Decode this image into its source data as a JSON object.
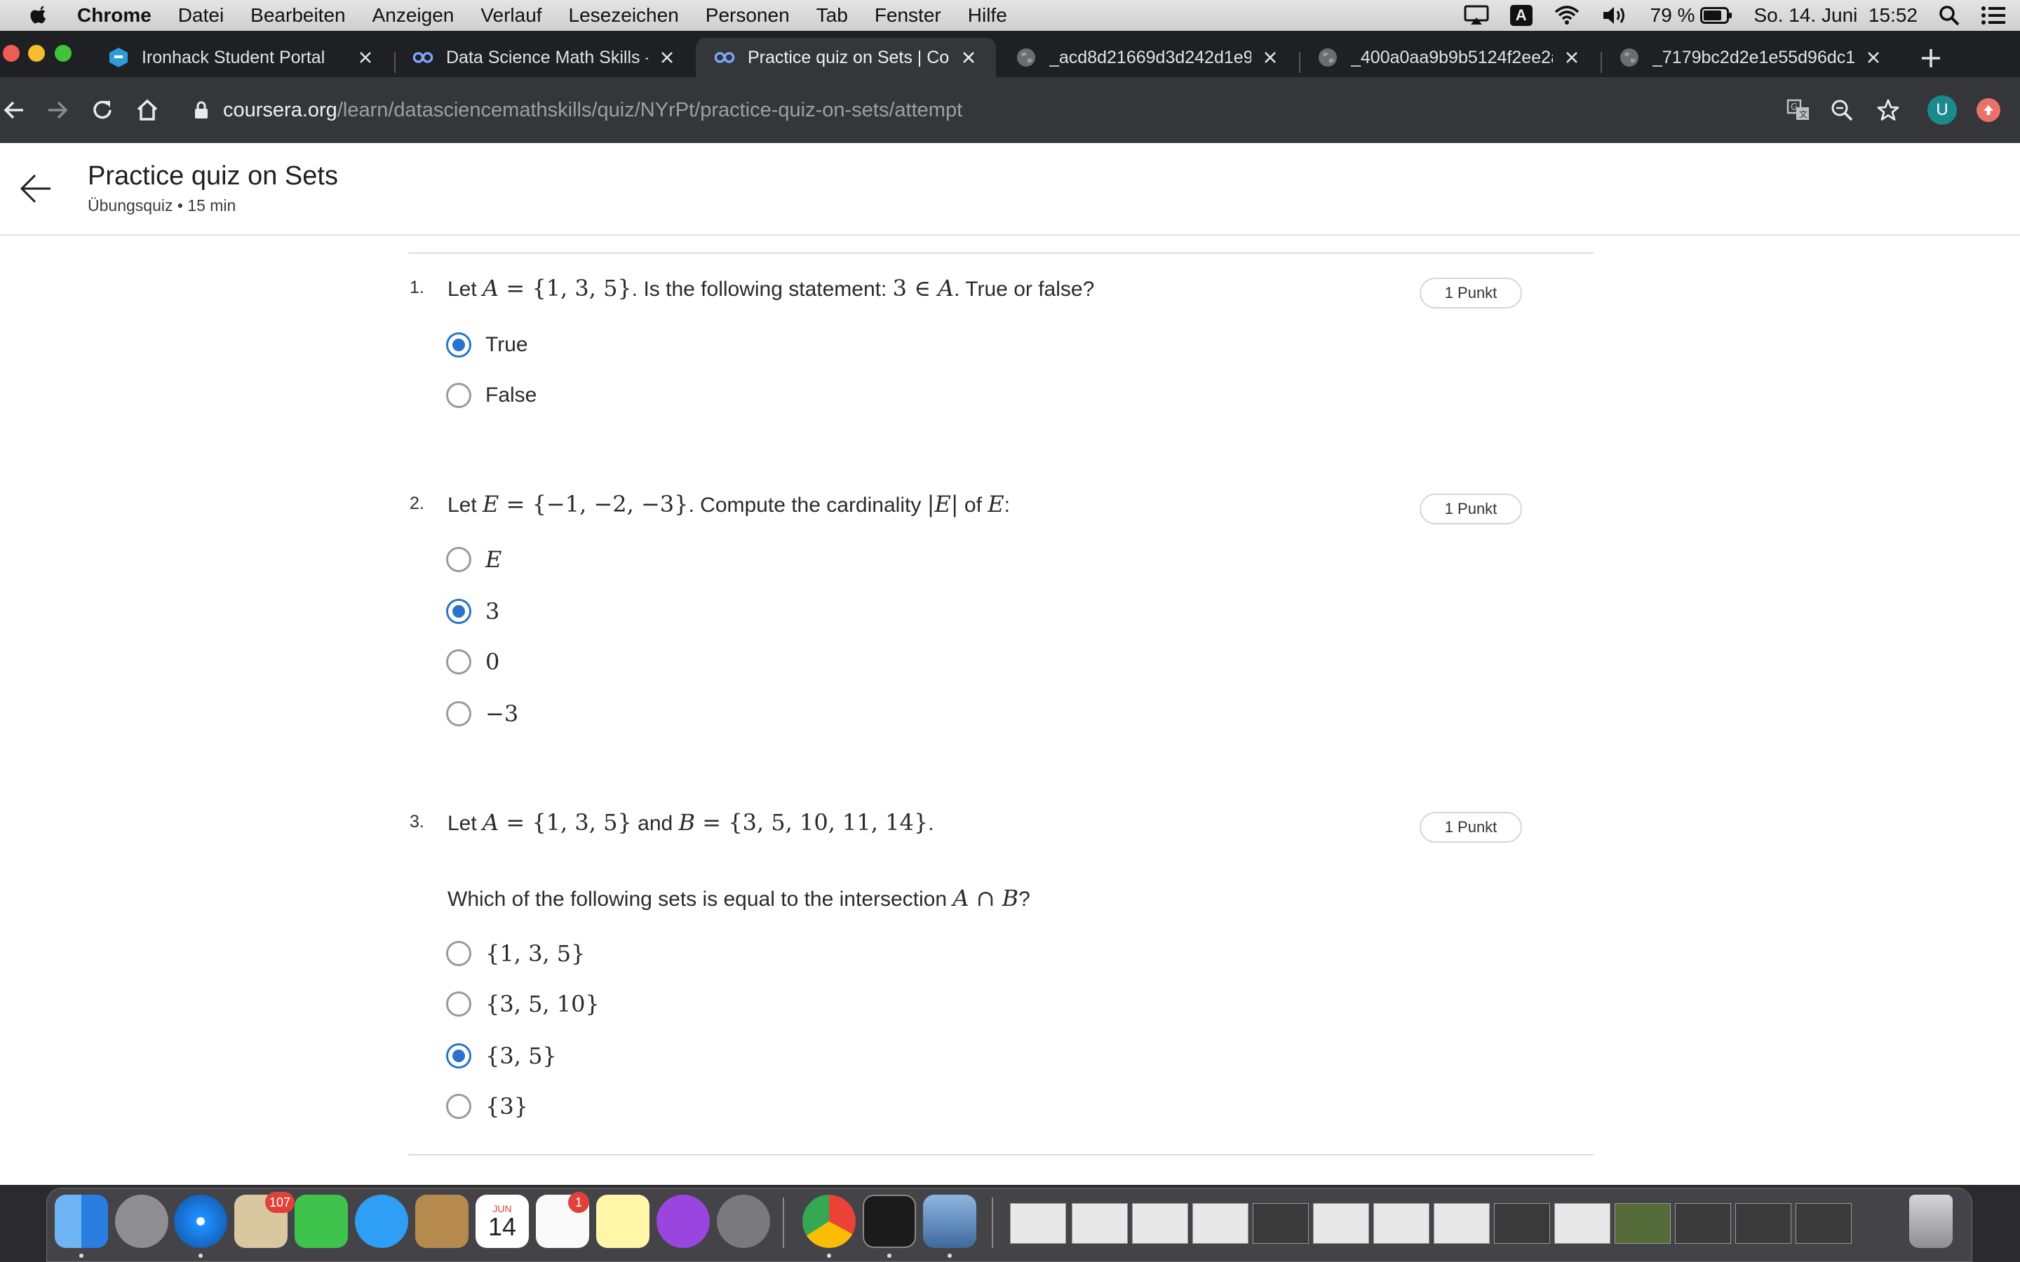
{
  "menubar": {
    "app": "Chrome",
    "items": [
      "Datei",
      "Bearbeiten",
      "Anzeigen",
      "Verlauf",
      "Lesezeichen",
      "Personen",
      "Tab",
      "Fenster",
      "Hilfe"
    ],
    "input_source": "A",
    "battery": "79 %",
    "datetime": "So. 14. Juni  15:52"
  },
  "tabs": [
    {
      "title": "Ironhack Student Portal",
      "icon": "ironhack-icon"
    },
    {
      "title": "Data Science Math Skills -",
      "icon": "coursera-icon"
    },
    {
      "title": "Practice quiz on Sets | Cou",
      "icon": "coursera-icon",
      "active": true
    },
    {
      "title": "_acd8d21669d3d242d1e9",
      "icon": "globe-icon"
    },
    {
      "title": "_400a0aa9b9b5124f2ee2a",
      "icon": "globe-icon"
    },
    {
      "title": "_7179bc2d2e1e55d96dc1",
      "icon": "globe-icon"
    }
  ],
  "address": {
    "host": "coursera.org",
    "path": "/learn/datasciencemathskills/quiz/NYrPt/practice-quiz-on-sets/attempt"
  },
  "profile_initial": "U",
  "header": {
    "title": "Practice quiz on Sets",
    "subtitle": "Übungsquiz • 15 min"
  },
  "questions": [
    {
      "number": "1.",
      "points": "1 Punkt",
      "parts": [
        [
          "t",
          "Let "
        ],
        [
          "m",
          "A"
        ],
        [
          "n",
          " = {1, 3, 5}"
        ],
        [
          "t",
          ". Is the following statement: "
        ],
        [
          "n",
          "3 ∈ "
        ],
        [
          "m",
          "A"
        ],
        [
          "t",
          ". True or false?"
        ]
      ],
      "options": [
        {
          "label": "True",
          "style": "text",
          "selected": true
        },
        {
          "label": "False",
          "style": "text",
          "selected": false
        }
      ]
    },
    {
      "number": "2.",
      "points": "1 Punkt",
      "parts": [
        [
          "t",
          "Let "
        ],
        [
          "m",
          "E"
        ],
        [
          "n",
          " = {−1, −2, −3}"
        ],
        [
          "t",
          ". Compute the cardinality "
        ],
        [
          "n",
          "|"
        ],
        [
          "m",
          "E"
        ],
        [
          "n",
          "|"
        ],
        [
          "t",
          " of "
        ],
        [
          "m",
          "E"
        ],
        [
          "t",
          ":"
        ]
      ],
      "options": [
        {
          "label": "E",
          "style": "math-italic",
          "selected": false
        },
        {
          "label": "3",
          "style": "math",
          "selected": true
        },
        {
          "label": "0",
          "style": "math",
          "selected": false
        },
        {
          "label": "−3",
          "style": "math",
          "selected": false
        }
      ]
    },
    {
      "number": "3.",
      "points": "1 Punkt",
      "parts": [
        [
          "t",
          "Let "
        ],
        [
          "m",
          "A"
        ],
        [
          "n",
          " = {1, 3, 5}"
        ],
        [
          "t",
          " and "
        ],
        [
          "m",
          "B"
        ],
        [
          "n",
          " = {3, 5, 10, 11, 14}"
        ],
        [
          "t",
          "."
        ]
      ],
      "prompt_parts": [
        [
          "t",
          "Which of the following sets is equal to the intersection "
        ],
        [
          "m",
          "A"
        ],
        [
          "n",
          " ∩ "
        ],
        [
          "m",
          "B"
        ],
        [
          "t",
          "?"
        ]
      ],
      "options": [
        {
          "label": "{1, 3, 5}",
          "style": "math",
          "selected": false
        },
        {
          "label": "{3, 5, 10}",
          "style": "math",
          "selected": false
        },
        {
          "label": "{3, 5}",
          "style": "math",
          "selected": true
        },
        {
          "label": "{3}",
          "style": "math",
          "selected": false
        }
      ]
    }
  ],
  "dock": {
    "mail_badge": "107",
    "calendar_month": "JUN",
    "calendar_day": "14",
    "reminders_badge": "1"
  },
  "colors": {
    "accent": "#2a73cc",
    "tabstrip": "#1f2023",
    "toolbar": "#35363a"
  }
}
